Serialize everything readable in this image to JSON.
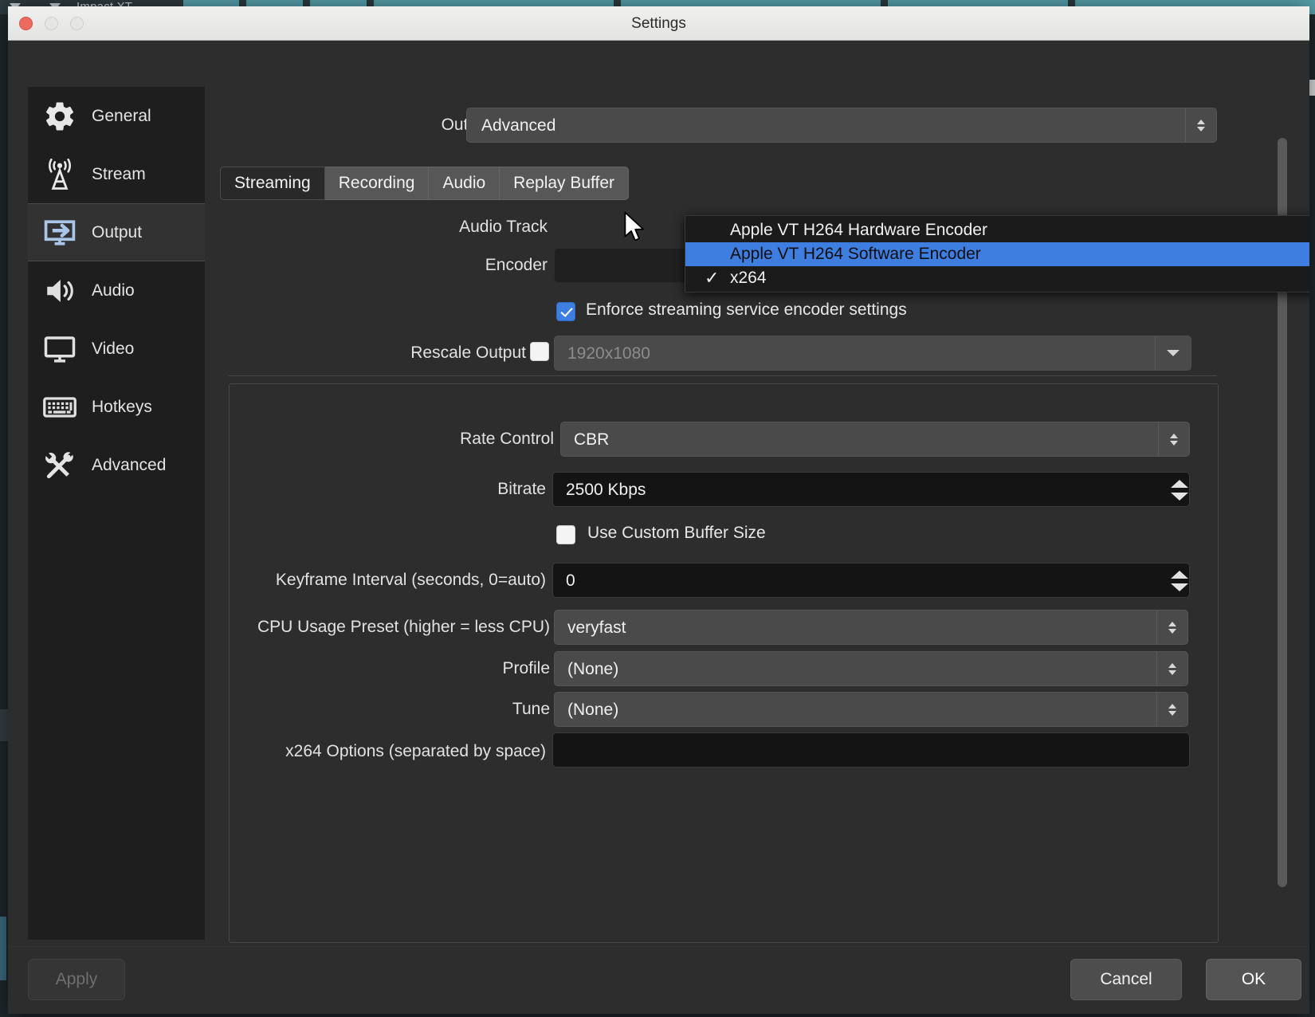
{
  "background": {
    "app_title": "Impact XT"
  },
  "window": {
    "title": "Settings",
    "traffic_lights": [
      "close",
      "minimize",
      "maximize"
    ]
  },
  "sidebar": {
    "items": [
      {
        "label": "General",
        "icon": "gear-icon",
        "selected": false
      },
      {
        "label": "Stream",
        "icon": "antenna-icon",
        "selected": false
      },
      {
        "label": "Output",
        "icon": "monitor-arrow-icon",
        "selected": true
      },
      {
        "label": "Audio",
        "icon": "speaker-icon",
        "selected": false
      },
      {
        "label": "Video",
        "icon": "display-icon",
        "selected": false
      },
      {
        "label": "Hotkeys",
        "icon": "keyboard-icon",
        "selected": false
      },
      {
        "label": "Advanced",
        "icon": "tools-icon",
        "selected": false
      }
    ]
  },
  "output_mode": {
    "label": "Output Mode",
    "value": "Advanced"
  },
  "tabs": [
    {
      "label": "Streaming",
      "active": true
    },
    {
      "label": "Recording",
      "active": false
    },
    {
      "label": "Audio",
      "active": false
    },
    {
      "label": "Replay Buffer",
      "active": false
    }
  ],
  "form": {
    "audio_track": {
      "label": "Audio Track",
      "value": ""
    },
    "encoder": {
      "label": "Encoder",
      "value": "x264"
    },
    "enforce": {
      "label": "Enforce streaming service encoder settings",
      "checked": true
    },
    "rescale": {
      "label": "Rescale Output",
      "checked": false,
      "placeholder": "1920x1080"
    },
    "rate_control": {
      "label": "Rate Control",
      "value": "CBR"
    },
    "bitrate": {
      "label": "Bitrate",
      "value": "2500 Kbps"
    },
    "custom_buffer": {
      "label": "Use Custom Buffer Size",
      "checked": false
    },
    "keyframe": {
      "label": "Keyframe Interval (seconds, 0=auto)",
      "value": "0"
    },
    "cpu_preset": {
      "label": "CPU Usage Preset (higher = less CPU)",
      "value": "veryfast"
    },
    "profile": {
      "label": "Profile",
      "value": "(None)"
    },
    "tune": {
      "label": "Tune",
      "value": "(None)"
    },
    "x264_options": {
      "label": "x264 Options (separated by space)",
      "value": ""
    }
  },
  "encoder_dropdown": {
    "open": true,
    "items": [
      {
        "label": "Apple VT H264 Hardware Encoder",
        "checked": false,
        "highlighted": false
      },
      {
        "label": "Apple VT H264 Software Encoder",
        "checked": false,
        "highlighted": true
      },
      {
        "label": "x264",
        "checked": true,
        "highlighted": false
      }
    ],
    "check_glyph": "✓"
  },
  "footer": {
    "apply": "Apply",
    "cancel": "Cancel",
    "ok": "OK"
  },
  "colors": {
    "accent_blue": "#3d7ee0",
    "dialog_bg": "#2d2d2d",
    "sidebar_bg": "#1e1e1e",
    "field_dark": "#141414",
    "field_gray": "#4a4a4a"
  }
}
